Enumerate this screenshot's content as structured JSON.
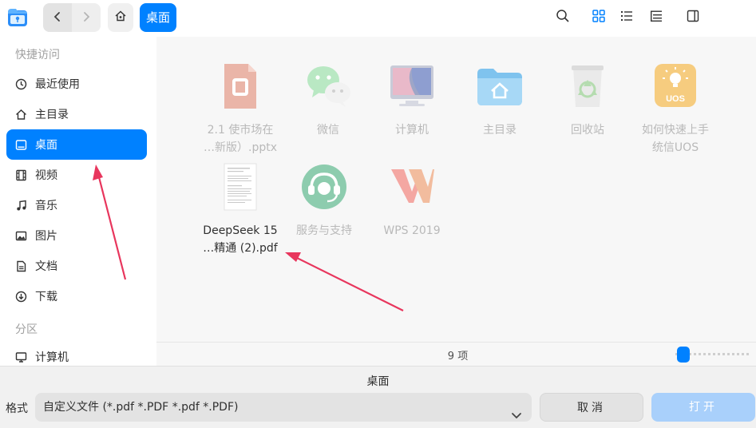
{
  "toolbar": {
    "app_icon": "file-manager-app-icon",
    "back_icon": "chevron-left-icon",
    "forward_icon": "chevron-right-icon",
    "home_icon": "home-icon",
    "breadcrumb_current": "桌面",
    "right_icons": [
      "search-icon",
      "icon-view-icon",
      "list-view-icon",
      "tree-view-icon",
      "preview-panel-icon"
    ],
    "accent_color": "#0081ff"
  },
  "sidebar": {
    "quick_access_header": "快捷访问",
    "items": [
      {
        "label": "最近使用",
        "icon": "clock-icon",
        "active": false
      },
      {
        "label": "主目录",
        "icon": "home-icon",
        "active": false
      },
      {
        "label": "桌面",
        "icon": "desktop-icon",
        "active": true
      },
      {
        "label": "视频",
        "icon": "film-icon",
        "active": false
      },
      {
        "label": "音乐",
        "icon": "music-note-icon",
        "active": false
      },
      {
        "label": "图片",
        "icon": "picture-icon",
        "active": false
      },
      {
        "label": "文档",
        "icon": "document-icon",
        "active": false
      },
      {
        "label": "下载",
        "icon": "download-icon",
        "active": false
      }
    ],
    "partition_header": "分区",
    "partition_items": [
      {
        "label": "计算机",
        "icon": "computer-icon"
      }
    ]
  },
  "files": [
    {
      "name_line1": "2.1 使市场在",
      "name_line2": "…新版）.pptx",
      "icon": "pptx-file-icon"
    },
    {
      "name_line1": "微信",
      "name_line2": "",
      "icon": "wechat-icon"
    },
    {
      "name_line1": "计算机",
      "name_line2": "",
      "icon": "computer-icon"
    },
    {
      "name_line1": "主目录",
      "name_line2": "",
      "icon": "home-folder-icon"
    },
    {
      "name_line1": "回收站",
      "name_line2": "",
      "icon": "trash-icon"
    },
    {
      "name_line1": "如何快速上手",
      "name_line2": "统信UOS",
      "icon": "uos-guide-icon"
    },
    {
      "name_line1": "DeepSeek 15",
      "name_line2": "…精通 (2).pdf",
      "icon": "pdf-file-icon"
    },
    {
      "name_line1": "服务与支持",
      "name_line2": "",
      "icon": "support-headset-icon"
    },
    {
      "name_line1": "WPS 2019",
      "name_line2": "",
      "icon": "wps-icon"
    }
  ],
  "status": {
    "item_count": "9 项",
    "zoom_level": 0.0
  },
  "bottom": {
    "title": "桌面",
    "format_label": "格式",
    "format_value": "自定义文件 (*.pdf *.PDF *.pdf *.PDF)",
    "cancel_label": "取消",
    "open_label": "打开"
  },
  "annotation_color": "#e8365d"
}
